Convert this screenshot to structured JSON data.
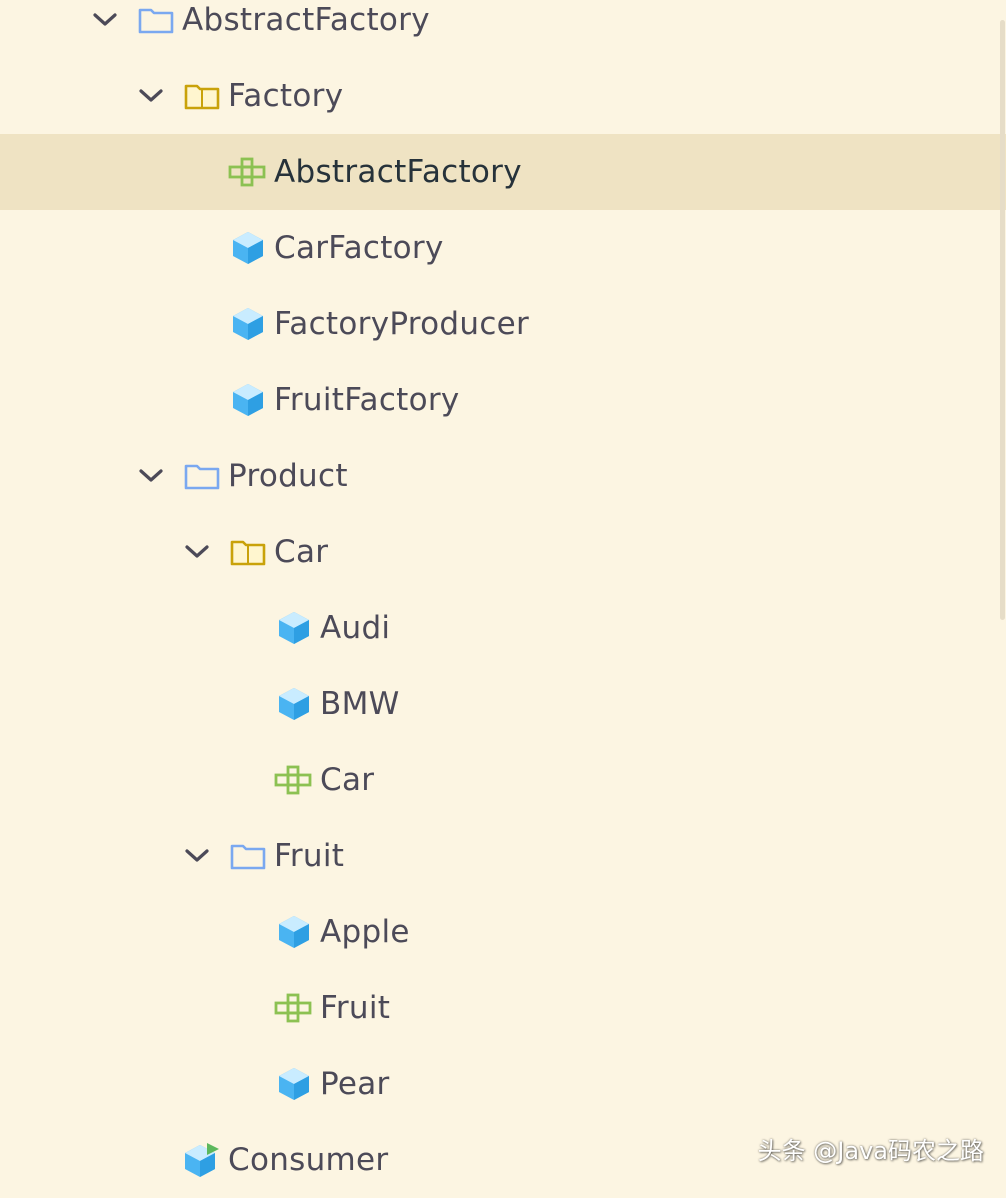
{
  "colors": {
    "background": "#fcf5e2",
    "selected_row": "#efe3c3",
    "folder_blue": "#7aa8f0",
    "package_yellow": "#c9a20a",
    "interface_green": "#8cc152",
    "class_cyan": "#4ab4f2"
  },
  "tree": {
    "items": [
      {
        "label": "AbstractFactory",
        "icon": "folder-icon",
        "depth": 0,
        "expanded": true
      },
      {
        "label": "Factory",
        "icon": "package-icon",
        "depth": 1,
        "expanded": true
      },
      {
        "label": "AbstractFactory",
        "icon": "interface-icon",
        "depth": 2,
        "selected": true
      },
      {
        "label": "CarFactory",
        "icon": "class-icon",
        "depth": 2
      },
      {
        "label": "FactoryProducer",
        "icon": "class-icon",
        "depth": 2
      },
      {
        "label": "FruitFactory",
        "icon": "class-icon",
        "depth": 2
      },
      {
        "label": "Product",
        "icon": "folder-icon",
        "depth": 1,
        "expanded": true
      },
      {
        "label": "Car",
        "icon": "package-icon",
        "depth": 2,
        "expanded": true
      },
      {
        "label": "Audi",
        "icon": "class-icon",
        "depth": 3
      },
      {
        "label": "BMW",
        "icon": "class-icon",
        "depth": 3
      },
      {
        "label": "Car",
        "icon": "interface-icon",
        "depth": 3
      },
      {
        "label": "Fruit",
        "icon": "folder-icon",
        "depth": 2,
        "expanded": true
      },
      {
        "label": "Apple",
        "icon": "class-icon",
        "depth": 3
      },
      {
        "label": "Fruit",
        "icon": "interface-icon",
        "depth": 3
      },
      {
        "label": "Pear",
        "icon": "class-icon",
        "depth": 3
      },
      {
        "label": "Consumer",
        "icon": "main-class-icon",
        "depth": 1
      }
    ]
  },
  "watermark": "头条 @Java码农之路"
}
